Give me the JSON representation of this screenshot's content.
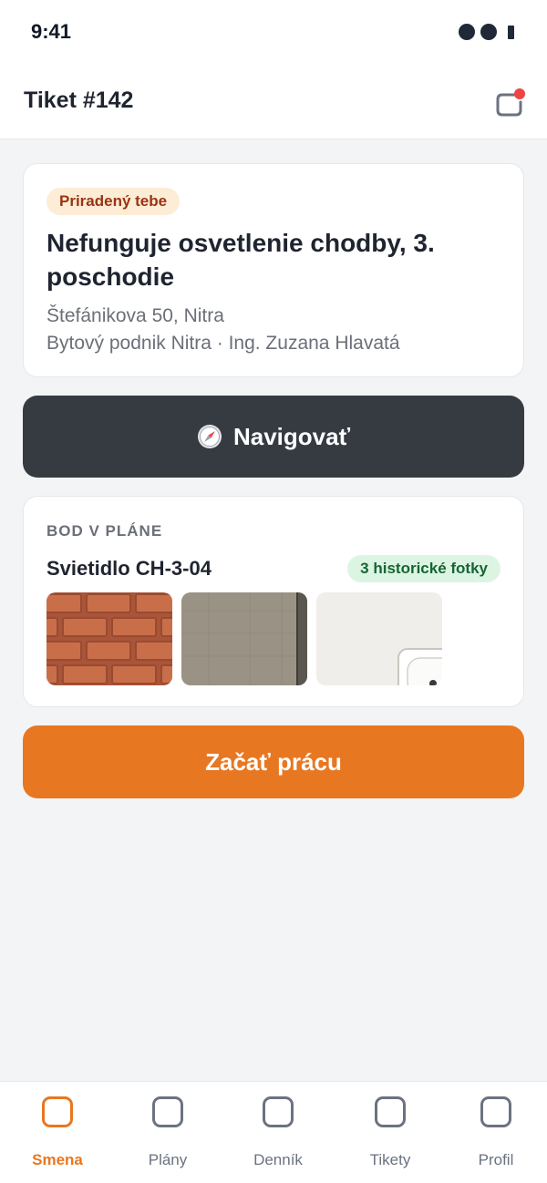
{
  "status_bar": {
    "time": "9:41"
  },
  "header": {
    "title": "Tiket #142"
  },
  "ticket": {
    "badge": "Priradený tebe",
    "title": "Nefunguje osvetlenie chodby, 3. poschodie",
    "address": "Štefánikova 50, Nitra",
    "client": "Bytový podnik Nitra · Ing. Zuzana Hlavatá"
  },
  "navigate_button": {
    "label": "Navigovať",
    "icon": "compass-icon"
  },
  "plan_point": {
    "section_label": "BOD V PLÁNE",
    "name": "Svietidlo CH-3-04",
    "photos_badge": "3 historické fotky"
  },
  "start_button": {
    "label": "Začať prácu"
  },
  "colors": {
    "accent": "#e87722",
    "dark_button": "#363b41",
    "badge_assigned_bg": "#fdecd6",
    "badge_photos_bg": "#dcf5e3",
    "notification_dot": "#ef4444"
  },
  "tabs": [
    {
      "label": "Smena",
      "active": true
    },
    {
      "label": "Plány",
      "active": false
    },
    {
      "label": "Denník",
      "active": false
    },
    {
      "label": "Tikety",
      "active": false
    },
    {
      "label": "Profil",
      "active": false
    }
  ]
}
